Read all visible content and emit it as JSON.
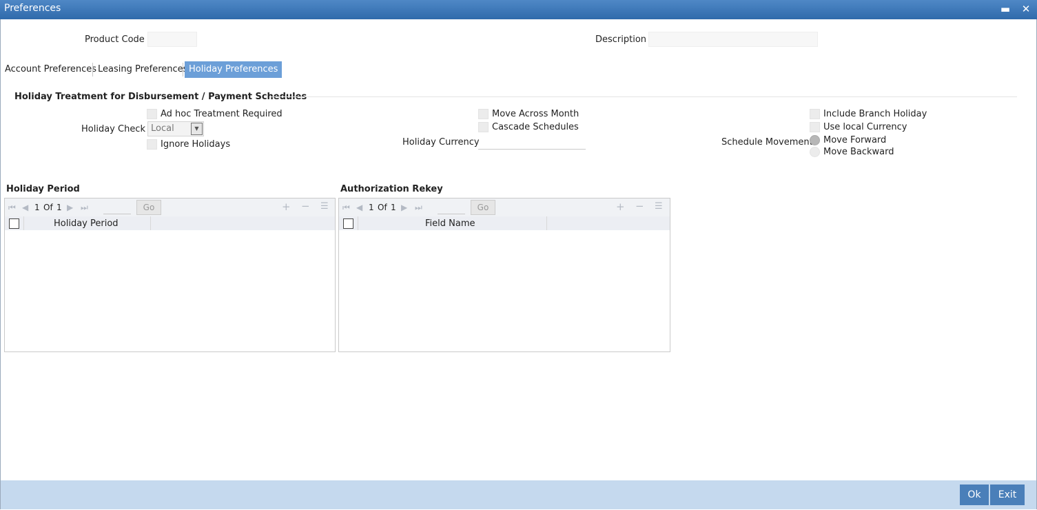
{
  "window": {
    "title": "Preferences",
    "minimize": "▬",
    "close": "✕"
  },
  "header": {
    "product_code_label": "Product Code",
    "product_code_value": "",
    "description_label": "Description",
    "description_value": ""
  },
  "tabs": [
    {
      "label": "Account Preferences",
      "active": false
    },
    {
      "label": "Leasing Preferences",
      "active": false
    },
    {
      "label": "Holiday Preferences",
      "active": true
    }
  ],
  "holiday_section": {
    "title": "Holiday Treatment for Disbursement / Payment Schedules",
    "adhoc_label": "Ad hoc Treatment Required",
    "holiday_check_label": "Holiday Check",
    "holiday_check_value": "Local",
    "ignore_holidays_label": "Ignore Holidays",
    "move_across_month_label": "Move Across Month",
    "cascade_schedules_label": "Cascade Schedules",
    "holiday_currency_label": "Holiday Currency",
    "holiday_currency_value": "",
    "include_branch_holiday_label": "Include Branch Holiday",
    "use_local_currency_label": "Use local Currency",
    "schedule_movement_label": "Schedule Movement",
    "move_forward_label": "Move Forward",
    "move_backward_label": "Move Backward",
    "schedule_movement_selected": "Move Forward"
  },
  "holiday_period_grid": {
    "title": "Holiday Period",
    "page_current": "1",
    "page_of": "Of",
    "page_total": "1",
    "go_label": "Go",
    "columns": [
      "Holiday Period"
    ]
  },
  "auth_rekey_grid": {
    "title": "Authorization Rekey",
    "page_current": "1",
    "page_of": "Of",
    "page_total": "1",
    "go_label": "Go",
    "columns": [
      "Field Name"
    ]
  },
  "footer": {
    "ok_label": "Ok",
    "exit_label": "Exit"
  },
  "colors": {
    "titlebar": "#3a75b8",
    "active_tab": "#6c9fd8",
    "footer": "#c5d9ee",
    "button": "#4a7fb9"
  }
}
